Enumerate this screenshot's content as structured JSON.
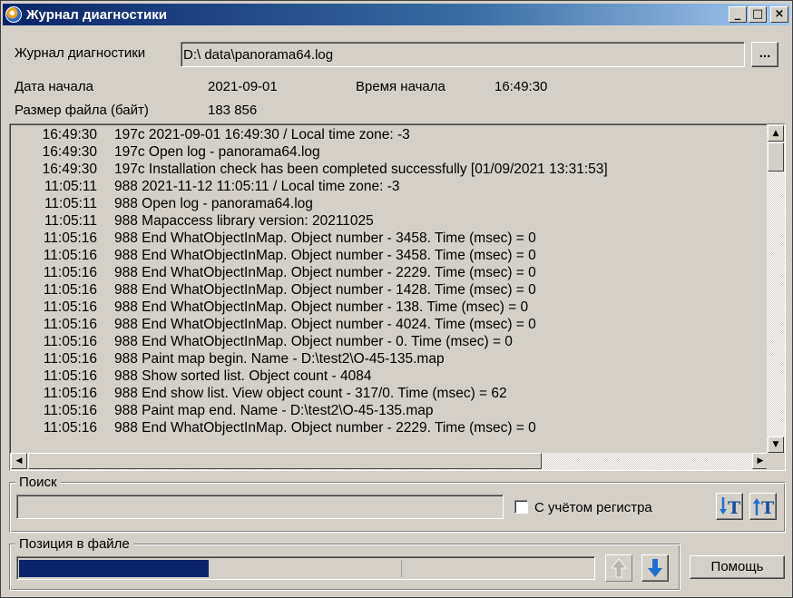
{
  "window": {
    "title": "Журнал диагностики",
    "minimize": "_",
    "maximize": "□",
    "close": "×"
  },
  "header": {
    "log_label": "Журнал диагностики",
    "log_path": "D:\\ data\\panorama64.log",
    "browse_label": "...",
    "start_date_label": "Дата начала",
    "start_date_value": "2021-09-01",
    "start_time_label": "Время начала",
    "start_time_value": "16:49:30",
    "file_size_label": "Размер файла (байт)",
    "file_size_value": "183 856"
  },
  "log": {
    "rows": [
      {
        "time": "16:49:30",
        "text": "197c 2021-09-01 16:49:30 / Local time zone: -3"
      },
      {
        "time": "16:49:30",
        "text": "197c Open log - panorama64.log"
      },
      {
        "time": "16:49:30",
        "text": "197c Installation check has been completed successfully [01/09/2021 13:31:53]"
      },
      {
        "time": "11:05:11",
        "text": "988 2021-11-12 11:05:11 / Local time zone: -3"
      },
      {
        "time": "11:05:11",
        "text": "988 Open log - panorama64.log"
      },
      {
        "time": "11:05:11",
        "text": "988 Mapaccess library version: 20211025"
      },
      {
        "time": "11:05:16",
        "text": "988 End WhatObjectInMap. Object number - 3458. Time (msec) = 0"
      },
      {
        "time": "11:05:16",
        "text": "988 End WhatObjectInMap. Object number - 3458. Time (msec) = 0"
      },
      {
        "time": "11:05:16",
        "text": "988 End WhatObjectInMap. Object number - 2229. Time (msec) = 0"
      },
      {
        "time": "11:05:16",
        "text": "988 End WhatObjectInMap. Object number - 1428. Time (msec) = 0"
      },
      {
        "time": "11:05:16",
        "text": "988 End WhatObjectInMap. Object number - 138. Time (msec) = 0"
      },
      {
        "time": "11:05:16",
        "text": "988 End WhatObjectInMap. Object number - 4024. Time (msec) = 0"
      },
      {
        "time": "11:05:16",
        "text": "988 End WhatObjectInMap. Object number - 0. Time (msec) = 0"
      },
      {
        "time": "11:05:16",
        "text": "988 Paint map begin. Name - D:\\test2\\O-45-135.map"
      },
      {
        "time": "11:05:16",
        "text": "988 Show sorted list. Object count - 4084"
      },
      {
        "time": "11:05:16",
        "text": "988 End show list. View object count - 317/0. Time (msec) = 62"
      },
      {
        "time": "11:05:16",
        "text": "988 Paint map end. Name - D:\\test2\\O-45-135.map"
      },
      {
        "time": "11:05:16",
        "text": "988 End WhatObjectInMap. Object number - 2229. Time (msec) = 0"
      }
    ]
  },
  "search": {
    "group_title": "Поиск",
    "input_value": "",
    "case_label": "С учётом регистра",
    "case_checked": false,
    "search_down_icon": "search-down-icon",
    "search_up_icon": "search-up-icon"
  },
  "position": {
    "group_title": "Позиция в файле",
    "progress_fraction": 0.33,
    "up_icon": "arrow-up-icon",
    "down_icon": "arrow-down-icon"
  },
  "footer": {
    "help_label": "Помощь"
  },
  "colors": {
    "accent": "#0a246a",
    "arrow_blue": "#1f6fd0",
    "face": "#d4d0c8"
  }
}
